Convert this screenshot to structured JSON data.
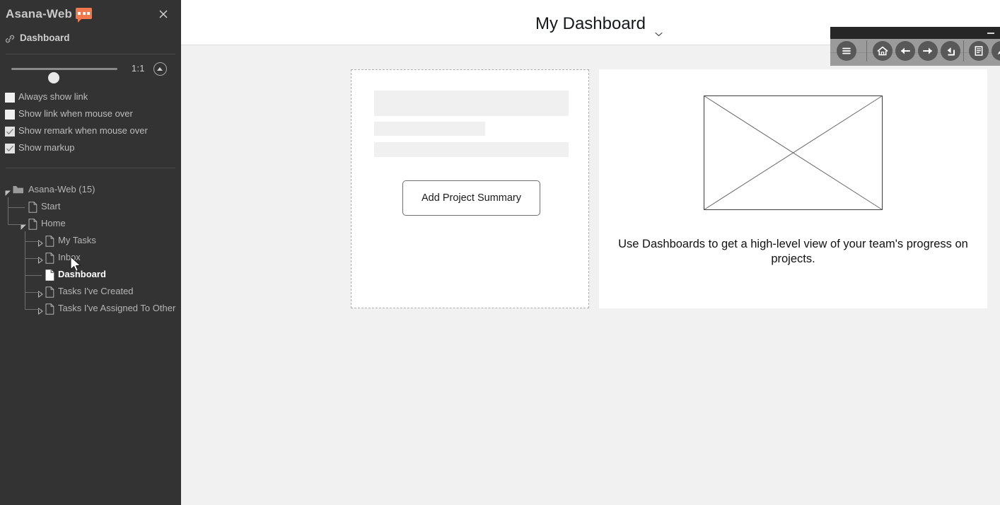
{
  "sidebar": {
    "app_title": "Asana-Web",
    "badge_icon": "chat-bubble-icon",
    "close_icon": "close-icon",
    "link": {
      "icon": "link-icon",
      "label": "Dashboard"
    },
    "zoom": {
      "ratio_label": "1:1",
      "collapse_icon": "collapse-up-icon",
      "slider_value": 24
    },
    "options": [
      {
        "label": "Always show link",
        "checked": false
      },
      {
        "label": "Show link when mouse over",
        "checked": false
      },
      {
        "label": "Show remark when mouse over",
        "checked": true
      },
      {
        "label": "Show markup",
        "checked": true
      }
    ],
    "tree": [
      {
        "label": "Asana-Web (15)",
        "icon": "folder-icon",
        "depth": 0,
        "expanded": true,
        "selected": false
      },
      {
        "label": "Start",
        "icon": "page-icon",
        "depth": 1,
        "expanded": null,
        "selected": false
      },
      {
        "label": "Home",
        "icon": "page-icon",
        "depth": 1,
        "expanded": true,
        "selected": false
      },
      {
        "label": "My Tasks",
        "icon": "page-icon",
        "depth": 2,
        "expanded": false,
        "selected": false
      },
      {
        "label": "Inbox",
        "icon": "page-icon",
        "depth": 2,
        "expanded": false,
        "selected": false
      },
      {
        "label": "Dashboard",
        "icon": "page-icon",
        "depth": 2,
        "expanded": null,
        "selected": true
      },
      {
        "label": "Tasks I've Created",
        "icon": "page-icon",
        "depth": 2,
        "expanded": false,
        "selected": false
      },
      {
        "label": "Tasks I've Assigned To Other",
        "icon": "page-icon",
        "depth": 2,
        "expanded": false,
        "selected": false
      }
    ]
  },
  "main": {
    "header": {
      "title": "My Dashboard",
      "chevron_icon": "chevron-down-icon"
    },
    "summary_panel": {
      "button_label": "Add Project Summary"
    },
    "info_card": {
      "image_placeholder_icon": "image-placeholder-icon",
      "text": "Use Dashboards to get a high-level view of your team's progress on projects."
    }
  },
  "toolbar": {
    "minimize_label": "",
    "buttons": [
      {
        "name": "menu-icon"
      },
      {
        "name": "home-icon"
      },
      {
        "name": "arrow-left-icon"
      },
      {
        "name": "arrow-right-icon"
      },
      {
        "name": "arrow-up-level-icon"
      },
      {
        "name": "notes-icon"
      },
      {
        "name": "pencil-icon"
      }
    ]
  },
  "colors": {
    "sidebar_bg": "#333333",
    "main_bg": "#f1f1f1",
    "accent_orange": "#f1774d",
    "card_bg": "#ffffff",
    "toolbar_bg": "#9b9b9b"
  }
}
